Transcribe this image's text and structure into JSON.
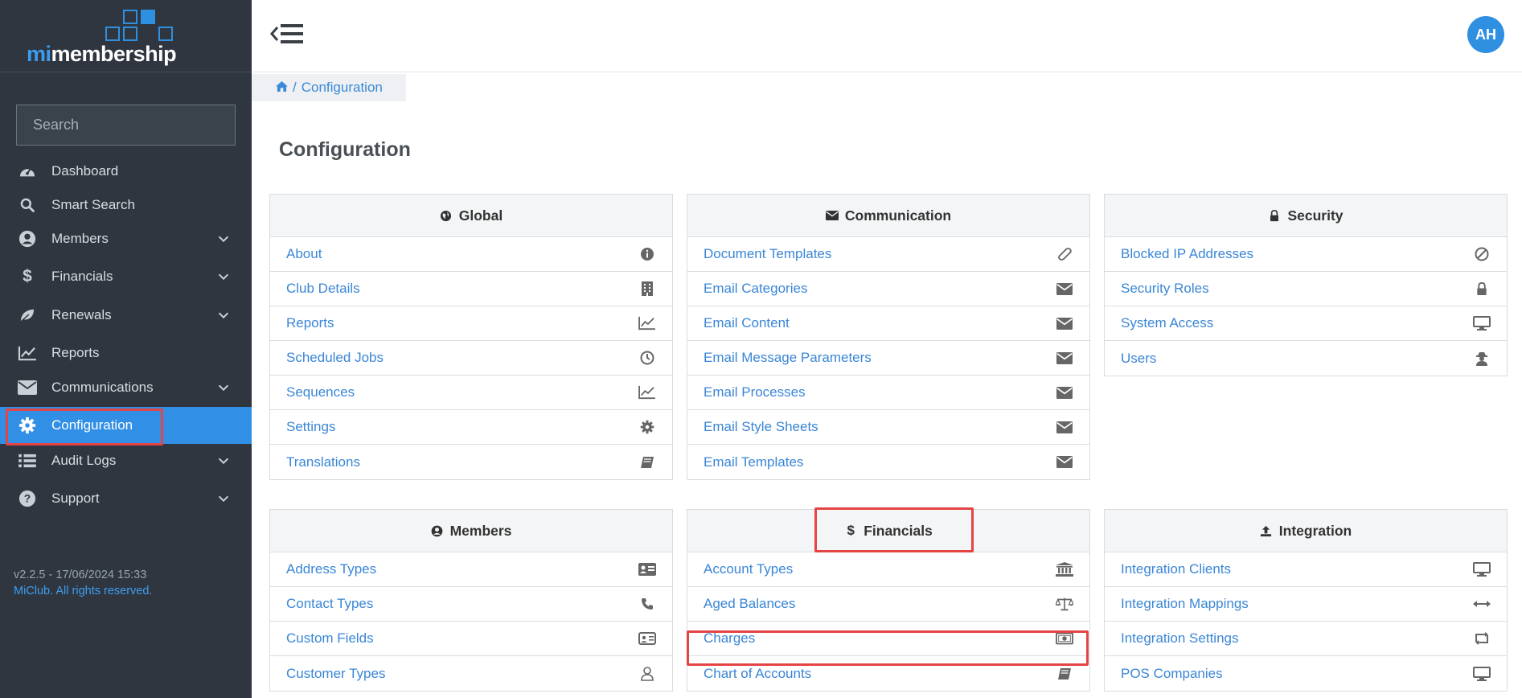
{
  "logo": {
    "mi": "mi",
    "rest": "membership"
  },
  "search": {
    "placeholder": "Search"
  },
  "nav": [
    {
      "label": "Dashboard"
    },
    {
      "label": "Smart Search"
    },
    {
      "label": "Members"
    },
    {
      "label": "Financials"
    },
    {
      "label": "Renewals"
    },
    {
      "label": "Reports"
    },
    {
      "label": "Communications"
    },
    {
      "label": "Configuration"
    },
    {
      "label": "Audit Logs"
    },
    {
      "label": "Support"
    }
  ],
  "footer": {
    "version": "v2.2.5 - 17/06/2024 15:33",
    "rights": "MiClub. All rights reserved."
  },
  "user": {
    "initials": "AH"
  },
  "breadcrumb": {
    "current": "Configuration",
    "sep": "/"
  },
  "page": {
    "title": "Configuration"
  },
  "panels": {
    "global": {
      "title": "Global",
      "items": [
        "About",
        "Club Details",
        "Reports",
        "Scheduled Jobs",
        "Sequences",
        "Settings",
        "Translations"
      ]
    },
    "communication": {
      "title": "Communication",
      "items": [
        "Document Templates",
        "Email Categories",
        "Email Content",
        "Email Message Parameters",
        "Email Processes",
        "Email Style Sheets",
        "Email Templates"
      ]
    },
    "security": {
      "title": "Security",
      "items": [
        "Blocked IP Addresses",
        "Security Roles",
        "System Access",
        "Users"
      ]
    },
    "members": {
      "title": "Members",
      "items": [
        "Address Types",
        "Contact Types",
        "Custom Fields",
        "Customer Types"
      ]
    },
    "financials": {
      "title": "Financials",
      "items": [
        "Account Types",
        "Aged Balances",
        "Charges",
        "Chart of Accounts"
      ]
    },
    "integration": {
      "title": "Integration",
      "items": [
        "Integration Clients",
        "Integration Mappings",
        "Integration Settings",
        "POS Companies"
      ]
    }
  },
  "colors": {
    "accent": "#3190e6",
    "sidebar": "#2f3640",
    "link": "#3a86d6",
    "highlight": "#e54444"
  }
}
